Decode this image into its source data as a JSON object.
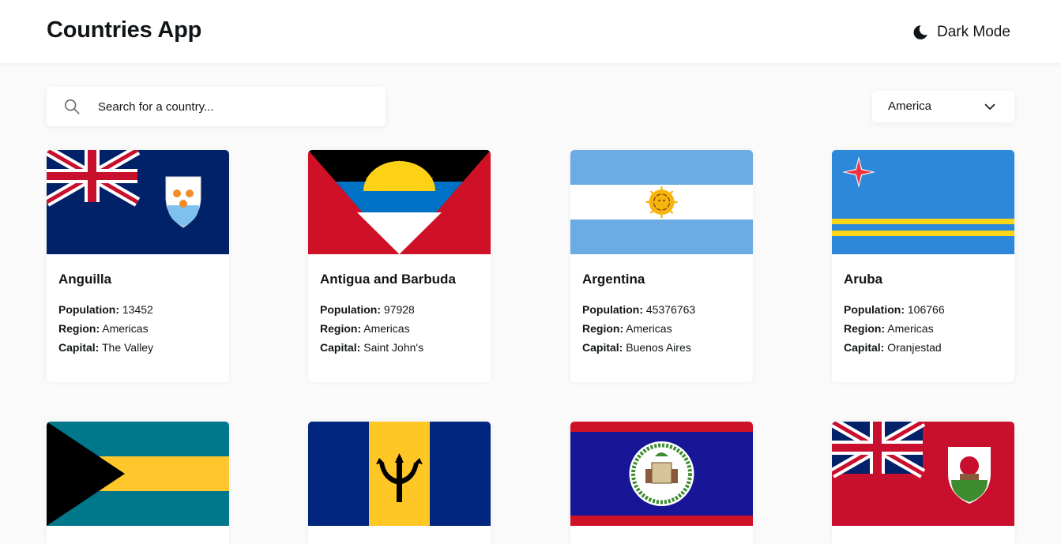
{
  "header": {
    "title": "Countries App",
    "dark_mode_label": "Dark Mode",
    "dark_mode_icon": "moon-icon"
  },
  "search": {
    "placeholder": "Search for a country...",
    "value": "",
    "icon": "search-icon"
  },
  "filter": {
    "selected": "America",
    "icon": "chevron-down-icon"
  },
  "labels": {
    "population": "Population:",
    "region": "Region:",
    "capital": "Capital:"
  },
  "countries": [
    {
      "name": "Anguilla",
      "population": "13452",
      "region": "Americas",
      "capital": "The Valley"
    },
    {
      "name": "Antigua and Barbuda",
      "population": "97928",
      "region": "Americas",
      "capital": "Saint John's"
    },
    {
      "name": "Argentina",
      "population": "45376763",
      "region": "Americas",
      "capital": "Buenos Aires"
    },
    {
      "name": "Aruba",
      "population": "106766",
      "region": "Americas",
      "capital": "Oranjestad"
    }
  ],
  "colors": {
    "background": "#fafafa",
    "card": "#ffffff",
    "text": "#111517"
  }
}
